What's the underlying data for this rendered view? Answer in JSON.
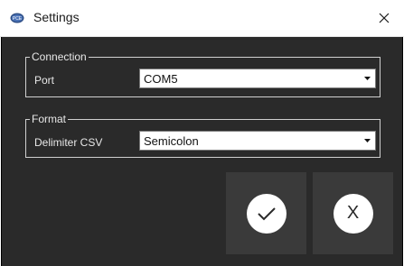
{
  "window": {
    "title": "Settings",
    "icon": "app-logo-icon",
    "close_icon": "close-icon"
  },
  "connection": {
    "legend": "Connection",
    "port_label": "Port",
    "port_value": "COM5"
  },
  "format": {
    "legend": "Format",
    "delimiter_label": "Delimiter CSV",
    "delimiter_value": "Semicolon"
  },
  "buttons": {
    "ok_icon": "checkmark-icon",
    "cancel_text": "X"
  },
  "colors": {
    "background": "#2a2a2a",
    "button_bg": "#3a3a3a",
    "text": "#e8e8e8"
  }
}
